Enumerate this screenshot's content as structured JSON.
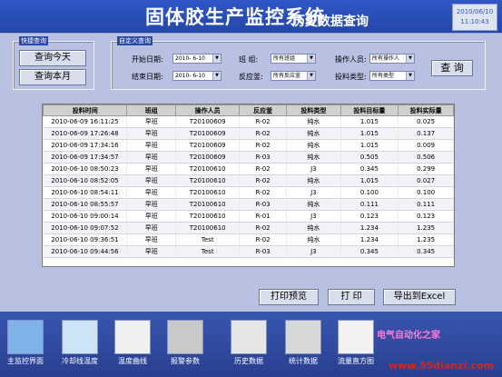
{
  "header": {
    "title": "固体胶生产监控系统",
    "subtitle": "历史数据查询",
    "clock_date": "2010/06/10",
    "clock_time": "11:10:43"
  },
  "quick": {
    "title": "快捷查询",
    "today": "查询今天",
    "month": "查询本月"
  },
  "custom": {
    "title": "自定义查询",
    "start_label": "开始日期:",
    "start_value": "2010- 6-10",
    "end_label": "结束日期:",
    "end_value": "2010- 6-10",
    "shift_label": "班  组:",
    "shift_value": "所有班组",
    "reactor_label": "反应釜:",
    "reactor_value": "所有反应釜",
    "operator_label": "操作人员:",
    "operator_value": "所有操作人",
    "type_label": "投料类型:",
    "type_value": "所有类型",
    "query": "查 询"
  },
  "table": {
    "columns": [
      "投料时间",
      "班组",
      "操作人员",
      "反应釜",
      "投料类型",
      "投料目标量",
      "投料实际量"
    ],
    "rows": [
      [
        "2010-06-09 16:11:25",
        "早班",
        "T20100609",
        "R-02",
        "纯水",
        "1.015",
        "0.025"
      ],
      [
        "2010-06-09 17:26:48",
        "早班",
        "T20100609",
        "R-02",
        "纯水",
        "1.015",
        "0.137"
      ],
      [
        "2010-06-09 17:34:16",
        "早班",
        "T20100609",
        "R-02",
        "纯水",
        "1.015",
        "0.009"
      ],
      [
        "2010-06-09 17:34:57",
        "早班",
        "T20100609",
        "R-03",
        "纯水",
        "0.505",
        "0.506"
      ],
      [
        "2010-06-10 08:50:23",
        "早班",
        "T20100610",
        "R-02",
        "J3",
        "0.345",
        "0.299"
      ],
      [
        "2010-06-10 08:52:05",
        "早班",
        "T20100610",
        "R-02",
        "纯水",
        "1.015",
        "0.027"
      ],
      [
        "2010-06-10 08:54:11",
        "早班",
        "T20100610",
        "R-02",
        "J3",
        "0.100",
        "0.100"
      ],
      [
        "2010-06-10 08:55:57",
        "早班",
        "T20100610",
        "R-03",
        "纯水",
        "0.111",
        "0.111"
      ],
      [
        "2010-06-10 09:00:14",
        "早班",
        "T20100610",
        "R-01",
        "J3",
        "0.123",
        "0.123"
      ],
      [
        "2010-06-10 09:07:52",
        "早班",
        "T20100610",
        "R-02",
        "纯水",
        "1.234",
        "1.235"
      ],
      [
        "2010-06-10 09:36:51",
        "早班",
        "Test",
        "R-02",
        "纯水",
        "1.234",
        "1.235"
      ],
      [
        "2010-06-10 09:44:56",
        "早班",
        "Test",
        "R-03",
        "J3",
        "0.345",
        "0.345"
      ]
    ]
  },
  "actions": {
    "preview": "打印预览",
    "print": "打 印",
    "export": "导出到Excel"
  },
  "nav": [
    "主监控界面",
    "冷却线温度",
    "温度曲线",
    "报警参数",
    "历史数据",
    "统计数据",
    "流量直方图"
  ],
  "watermark": {
    "line1": "电气自动化之家",
    "line2": "www.55dianzi.com"
  }
}
